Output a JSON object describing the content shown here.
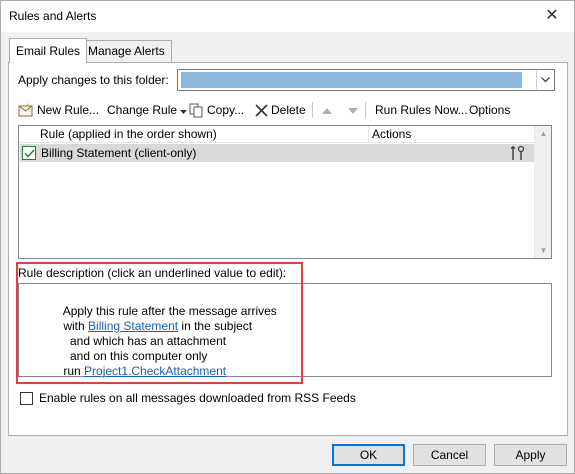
{
  "window": {
    "title": "Rules and Alerts",
    "close_glyph": "✕"
  },
  "tabs": [
    {
      "label": "Email Rules",
      "active": true
    },
    {
      "label": "Manage Alerts",
      "active": false
    }
  ],
  "folder": {
    "label": "Apply changes to this folder:",
    "selected_value": ""
  },
  "toolbar": {
    "new_rule": "New Rule...",
    "change_rule": "Change Rule",
    "copy": "Copy...",
    "delete": "Delete",
    "run_rules_now": "Run Rules Now...",
    "options": "Options"
  },
  "rules_list": {
    "columns": [
      "Rule (applied in the order shown)",
      "Actions"
    ],
    "rows": [
      {
        "name": "Billing Statement  (client-only)",
        "checked": true,
        "selected": true
      }
    ]
  },
  "description": {
    "label": "Rule description (click an underlined value to edit):",
    "lines": [
      {
        "prefix": "Apply this rule after the message arrives",
        "link": "",
        "suffix": ""
      },
      {
        "prefix": "with ",
        "link": "Billing Statement",
        "suffix": " in the subject"
      },
      {
        "prefix": "  and which has an attachment",
        "link": "",
        "suffix": ""
      },
      {
        "prefix": "  and on this computer only",
        "link": "",
        "suffix": ""
      },
      {
        "prefix": "run ",
        "link": "Project1.CheckAttachment",
        "suffix": ""
      }
    ]
  },
  "rss": {
    "label": "Enable rules on all messages downloaded from RSS Feeds",
    "checked": false
  },
  "buttons": {
    "ok": "OK",
    "cancel": "Cancel",
    "apply": "Apply"
  },
  "colors": {
    "link": "#1a5fb4",
    "highlight_border": "#e83b4a",
    "selected_row": "#d9d9d9",
    "folder_selection": "#8fb8e0"
  }
}
